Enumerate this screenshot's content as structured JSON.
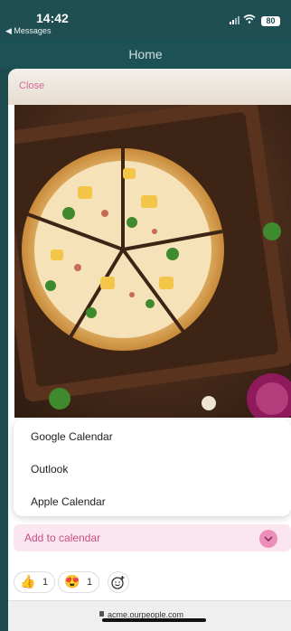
{
  "status_bar": {
    "time": "14:42",
    "back_label": "◀ Messages",
    "battery": "80"
  },
  "navbar": {
    "title": "Home"
  },
  "sheet": {
    "close_label": "Close"
  },
  "calendar_menu": {
    "items": [
      "Google Calendar",
      "Outlook",
      "Apple Calendar"
    ]
  },
  "add_to_calendar": {
    "label": "Add to calendar"
  },
  "reactions": [
    {
      "emoji": "👍",
      "count": "1"
    },
    {
      "emoji": "😍",
      "count": "1"
    }
  ],
  "url_bar": {
    "url": "acme.ourpeople.com"
  }
}
